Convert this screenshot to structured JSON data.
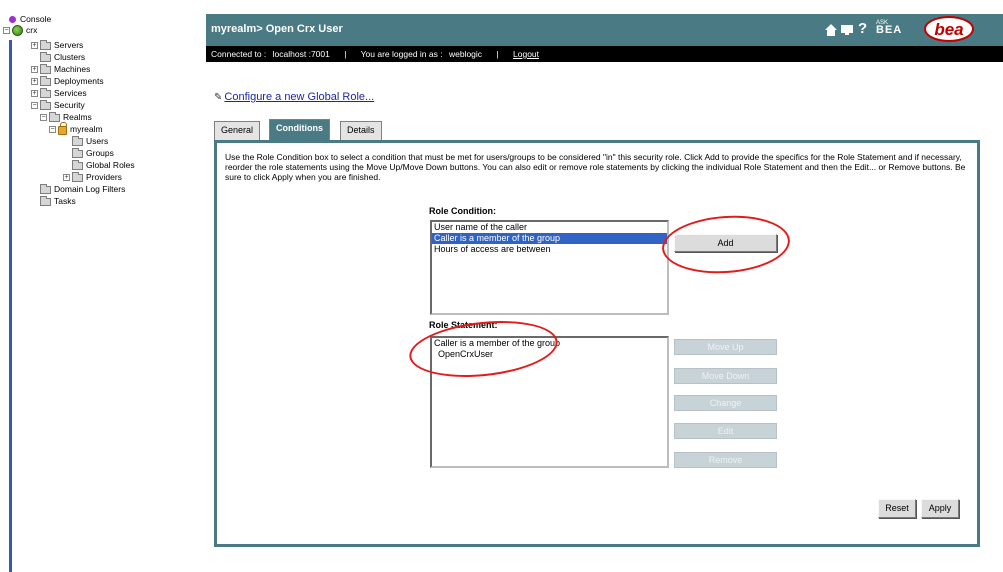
{
  "tree": {
    "items": [
      {
        "label": "Console"
      },
      {
        "label": "crx"
      },
      {
        "label": "Servers"
      },
      {
        "label": "Clusters"
      },
      {
        "label": "Machines"
      },
      {
        "label": "Deployments"
      },
      {
        "label": "Services"
      },
      {
        "label": "Security"
      },
      {
        "label": "Realms"
      },
      {
        "label": "myrealm"
      },
      {
        "label": "Users"
      },
      {
        "label": "Groups"
      },
      {
        "label": "Global Roles"
      },
      {
        "label": "Providers"
      },
      {
        "label": "Domain Log Filters"
      },
      {
        "label": "Tasks"
      }
    ]
  },
  "header": {
    "title": "myrealm> Open Crx User",
    "ask_label": "ASK",
    "bea_label": "BEA",
    "logo_text": "bea",
    "connected_label": "Connected to :",
    "connected_value": "localhost :7001",
    "logged_in_label": "You are logged in as :",
    "logged_in_value": "weblogic",
    "logout": "Logout"
  },
  "main": {
    "new_role_link": "Configure a new Global Role...",
    "tabs": [
      {
        "label": "General",
        "active": false
      },
      {
        "label": "Conditions",
        "active": true
      },
      {
        "label": "Details",
        "active": false
      }
    ],
    "instructions": "Use the Role Condition box to select a condition that must be met for users/groups to be considered \"in\" this security role. Click Add to provide the specifics for the Role Statement and if necessary, reorder the role statements using the Move Up/Move Down buttons. You can also edit or remove role statements by clicking the individual Role Statement and then the Edit... or Remove buttons. Be sure to click Apply when you are finished.",
    "role_condition": {
      "label": "Role Condition:",
      "options": [
        "User name of the caller",
        "Caller is a member of the group",
        "Hours of access are between"
      ],
      "selected_index": 1,
      "add_button": "Add"
    },
    "role_statement": {
      "label": "Role Statement:",
      "lines": [
        "Caller is a member of the group",
        "OpenCrxUser"
      ],
      "buttons": [
        "Move Up",
        "Move Down",
        "Change",
        "Edit",
        "Remove"
      ]
    },
    "reset_button": "Reset",
    "apply_button": "Apply"
  },
  "colors": {
    "header_bg": "#4a7a83",
    "selection": "#3163c4",
    "annotation": "#e41b1b"
  }
}
